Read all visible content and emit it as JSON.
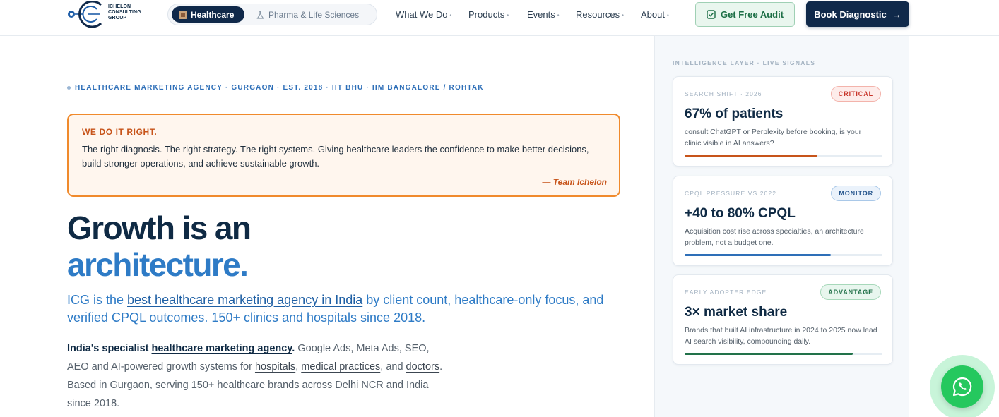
{
  "nav": {
    "logo_lines": [
      "ICHELON",
      "CONSULTING",
      "GROUP"
    ],
    "segments": [
      {
        "label": "Healthcare",
        "active": true
      },
      {
        "label": "Pharma & Life Sciences",
        "active": false
      }
    ],
    "menu": [
      {
        "label": "What We Do"
      },
      {
        "label": "Products"
      },
      {
        "label": "Events"
      },
      {
        "label": "Resources"
      },
      {
        "label": "About"
      }
    ],
    "cta_audit": "Get Free Audit",
    "cta_book": "Book Diagnostic",
    "book_arrow": "→"
  },
  "hero": {
    "eyebrow": "HEALTHCARE MARKETING AGENCY · GURGAON · EST. 2018 · IIT BHU · IIM BANGALORE / ROHTAK",
    "quote": {
      "heading": "WE DO IT RIGHT.",
      "body": "The right diagnosis. The right strategy. The right systems. Giving healthcare leaders the confidence to make better decisions, build stronger operations, and achieve sustainable growth.",
      "signature": "— Team Ichelon"
    },
    "headline_line1": "Growth is an",
    "headline_line2": "architecture.",
    "lead": {
      "prefix": "ICG is the ",
      "link": "best healthcare marketing agency in India",
      "suffix": " by client count, healthcare-only focus, and verified CPQL outcomes. 150+ clinics and hospitals since 2018."
    },
    "body": {
      "strong": "India's specialist ",
      "strong_link": "healthcare marketing agency",
      "strong_end": ".",
      "t1": " Google Ads, Meta Ads, SEO, AEO and AI-powered growth systems for ",
      "link1": "hospitals",
      "t2": ", ",
      "link2": "medical practices",
      "t3": ", and ",
      "link3": "doctors",
      "t4": ". Based in Gurgaon, serving 150+ healthcare brands across Delhi NCR and India since 2018."
    }
  },
  "panel": {
    "label": "INTELLIGENCE LAYER · LIVE SIGNALS",
    "cards": [
      {
        "kicker": "SEARCH SHIFT · 2026",
        "badge": "CRITICAL",
        "stat": "67% of patients",
        "desc": "consult ChatGPT or Perplexity before booking, is your clinic visible in AI answers?",
        "progress": 0.67,
        "color": "#c7541a"
      },
      {
        "kicker": "CPQL PRESSURE VS 2022",
        "badge": "MONITOR",
        "stat": "+40 to 80% CPQL",
        "desc": "Acquisition cost rise across specialties, an architecture problem, not a budget one.",
        "progress": 0.74,
        "color": "#2e6fb8"
      },
      {
        "kicker": "EARLY ADOPTER EDGE",
        "badge": "ADVANTAGE",
        "stat": "3× market share",
        "desc": "Brands that built AI infrastructure in 2024 to 2025 now lead AI search visibility, compounding daily.",
        "progress": 0.85,
        "color": "#22724a"
      }
    ]
  },
  "icons": {
    "logo": "ichelon-logo-icon",
    "healthcare": "hospital-icon",
    "pharma": "flask-icon",
    "audit": "checkbox-icon",
    "whatsapp": "whatsapp-icon"
  }
}
